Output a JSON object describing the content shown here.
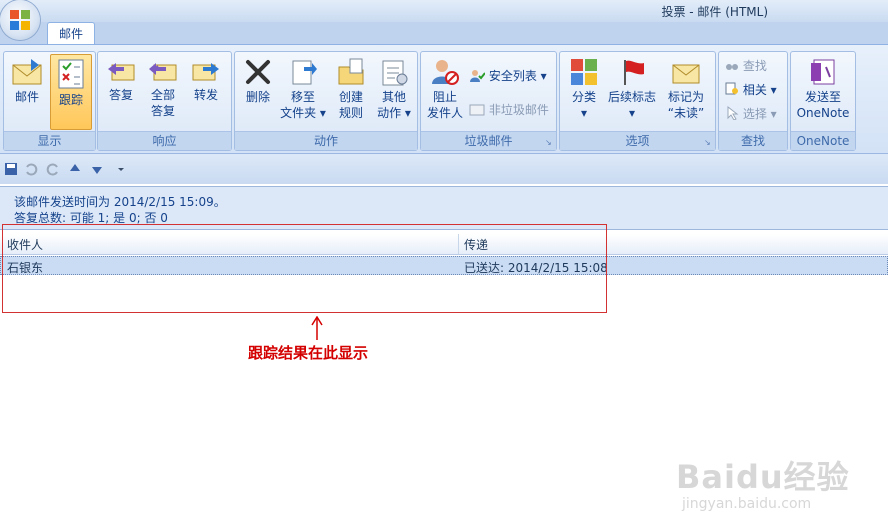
{
  "window": {
    "title": "投票 - 邮件 (HTML)"
  },
  "tabs": [
    {
      "label": "邮件"
    }
  ],
  "ribbon": {
    "groups": {
      "show": {
        "label": "显示",
        "mail": "邮件",
        "track": "跟踪"
      },
      "respond": {
        "label": "响应",
        "reply": "答复",
        "reply_all_1": "全部",
        "reply_all_2": "答复",
        "forward": "转发"
      },
      "actions": {
        "label": "动作",
        "delete": "删除",
        "move_1": "移至",
        "move_2": "文件夹",
        "create_rule_1": "创建",
        "create_rule_2": "规则",
        "other_1": "其他",
        "other_2": "动作"
      },
      "junk": {
        "label": "垃圾邮件",
        "block_1": "阻止",
        "block_2": "发件人",
        "safe_list": "安全列表",
        "not_junk": "非垃圾邮件"
      },
      "options": {
        "label": "选项",
        "categorize": "分类",
        "follow_up": "后续标志",
        "mark_unread_1": "标记为",
        "mark_unread_2": "“未读”"
      },
      "find": {
        "label": "查找",
        "find": "查找",
        "related": "相关",
        "select": "选择"
      },
      "onenote": {
        "label": "OneNote",
        "send_1": "发送至",
        "send_2": "OneNote"
      }
    }
  },
  "info": {
    "line1": "该邮件发送时间为 2014/2/15 15:09。",
    "line2": "答复总数: 可能 1; 是 0; 否 0"
  },
  "table": {
    "headers": [
      "收件人",
      "传递"
    ],
    "rows": [
      {
        "recipient": "石银东",
        "delivery": "已送达: 2014/2/15 15:08"
      }
    ]
  },
  "annotation": {
    "text": "跟踪结果在此显示"
  },
  "watermark": {
    "text": "Baidu经验",
    "url": "jingyan.baidu.com"
  },
  "colors": {
    "accent": "#15428b",
    "highlight": "#ffc75a",
    "annotation": "#d40000"
  }
}
